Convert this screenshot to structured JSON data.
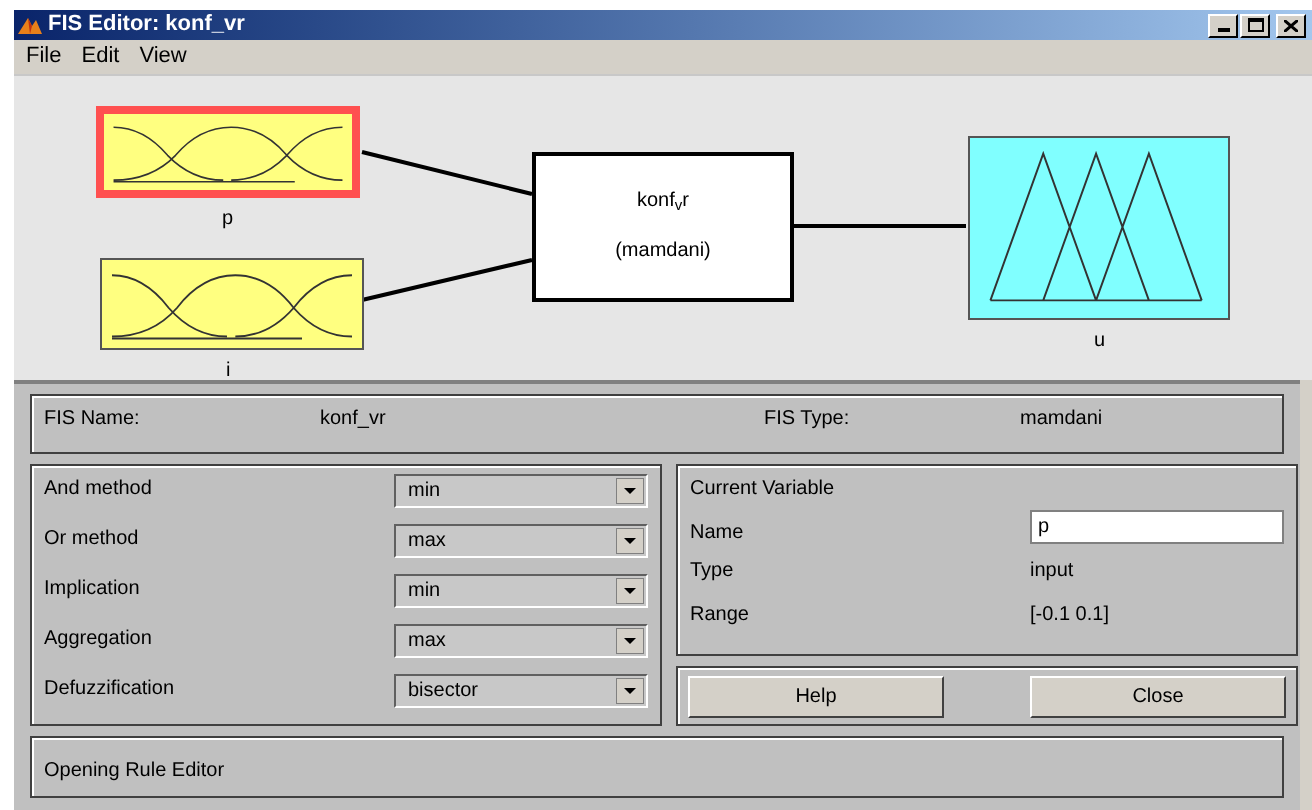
{
  "window": {
    "title": "FIS Editor: konf_vr"
  },
  "menu": [
    "File",
    "Edit",
    "View"
  ],
  "diagram": {
    "inputs": [
      {
        "label": "p",
        "selected": true
      },
      {
        "label": "i",
        "selected": false
      }
    ],
    "system": {
      "name": "konf$_{v}$r",
      "type": "(mamdani)"
    },
    "outputs": [
      {
        "label": "u",
        "selected": false
      }
    ]
  },
  "fis_info": {
    "name_label": "FIS Name:",
    "name": "konf_vr",
    "type_label": "FIS Type:",
    "type": "mamdani"
  },
  "methods": [
    {
      "label": "And method",
      "value": "min"
    },
    {
      "label": "Or method",
      "value": "max"
    },
    {
      "label": "Implication",
      "value": "min"
    },
    {
      "label": "Aggregation",
      "value": "max"
    },
    {
      "label": "Defuzzification",
      "value": "bisector"
    }
  ],
  "current_variable": {
    "title": "Current Variable",
    "name_label": "Name",
    "name": "p",
    "type_label": "Type",
    "type": "input",
    "range_label": "Range",
    "range": "[-0.1 0.1]"
  },
  "buttons": [
    "Help",
    "Close"
  ],
  "status": "Opening Rule Editor"
}
